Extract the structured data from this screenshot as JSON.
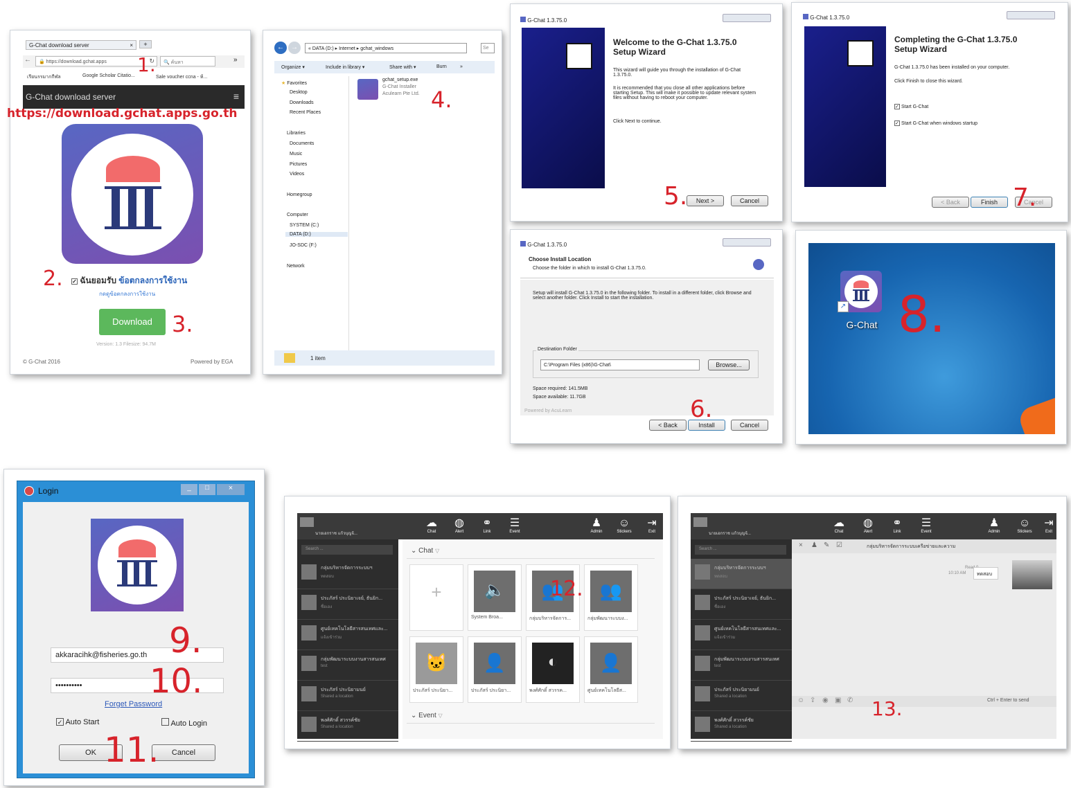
{
  "browser": {
    "tab_title": "G-Chat download server",
    "url": "https://download.gchat.apps",
    "search_placeholder": "ค้นหา",
    "bookmarks": [
      "เรียนรรมากกีฬล",
      "Google Scholar Citatio...",
      "Sale voucher ccna - ห้..."
    ],
    "page_header": "G-Chat download server",
    "url_caption": "https://download.gchat.apps.go.th",
    "accept_prefix": "ฉันยอมรับ",
    "accept_link": "ข้อตกลงการใช้งาน",
    "terms_link": "กดดูข้อตกลงการใช้งาน",
    "download_label": "Download",
    "version": "Version: 1.3 Filesize: 94.7M",
    "footer_left": "© G-Chat 2016",
    "footer_right": "Powered by EGA"
  },
  "explorer": {
    "path": "« DATA (D:) ▸ Internet ▸ gchat_windows",
    "search": "Se",
    "toolbar": [
      "Organize ▾",
      "Include in library ▾",
      "Share with ▾",
      "Burn",
      "»"
    ],
    "nav": [
      "Favorites",
      "Desktop",
      "Downloads",
      "Recent Places",
      "Libraries",
      "Documents",
      "Music",
      "Pictures",
      "Videos",
      "Homegroup",
      "Computer",
      "SYSTEM (C:)",
      "DATA (D:)",
      "JO-SDC (F:)",
      "Network"
    ],
    "file_name": "gchat_setup.exe",
    "file_desc": "G-Chat Installer",
    "file_company": "Aculearn Pte Ltd.",
    "status": "1 item"
  },
  "setup_welcome": {
    "title": "G-Chat 1.3.75.0",
    "heading": "Welcome to the G-Chat 1.3.75.0 Setup Wizard",
    "p1": "This wizard will guide you through the installation of G-Chat 1.3.75.0.",
    "p2": "It is recommended that you close all other applications before starting Setup. This will make it possible to update relevant system files without having to reboot your computer.",
    "p3": "Click Next to continue.",
    "next": "Next >",
    "cancel": "Cancel"
  },
  "setup_complete": {
    "title": "G-Chat 1.3.75.0",
    "heading": "Completing the G-Chat 1.3.75.0 Setup Wizard",
    "p1": "G-Chat 1.3.75.0 has been installed on your computer.",
    "p2": "Click Finish to close this wizard.",
    "cb1": "Start G-Chat",
    "cb2": "Start G-Chat when windows startup",
    "back": "< Back",
    "finish": "Finish",
    "cancel": "Cancel"
  },
  "setup_location": {
    "title": "G-Chat 1.3.75.0",
    "heading": "Choose Install Location",
    "sub": "Choose the folder in which to install G-Chat 1.3.75.0.",
    "p1": "Setup will install G-Chat 1.3.75.0 in the following folder. To install in a different folder, click Browse and select another folder. Click Install to start the installation.",
    "dest_label": "Destination Folder",
    "dest_value": "C:\\Program Files (x86)\\G-Chat\\",
    "browse": "Browse...",
    "space_req": "Space required: 141.5MB",
    "space_avail": "Space available: 11.7GB",
    "powered": "Powered by AcuLearn",
    "back": "< Back",
    "install": "Install",
    "cancel": "Cancel"
  },
  "desktop": {
    "icon_label": "G-Chat"
  },
  "login": {
    "title": "Login",
    "email": "akkaracihk@fisheries.go.th",
    "password": "••••••••••",
    "forget": "Forget Password",
    "auto_start": "Auto Start",
    "auto_login": "Auto Login",
    "ok": "OK",
    "cancel": "Cancel"
  },
  "gchat_main": {
    "user": "นายเอกราช แก้วบุญจ้...",
    "tools": [
      "Chat",
      "Alert",
      "Link",
      "Event"
    ],
    "tools_right": [
      "Admin",
      "Stickers",
      "Exit"
    ],
    "search": "Search ...",
    "chats": [
      {
        "t": "กลุ่มบริหารจัดการระบบฯ",
        "s": "ทดสอบ"
      },
      {
        "t": "ประภัสร์ ประนิยาเจย์, ธันยิก...",
        "s": "ชื่อเอง"
      },
      {
        "t": "ศูนย์เทคโนโลยีสารสนเทศและ...",
        "s": "แจ้งเข้าร่วม"
      },
      {
        "t": "กลุ่มพัฒนาระบบงานสารสนเทศ",
        "s": "test"
      },
      {
        "t": "ประภัสร์ ประนิยามนย์",
        "s": "Shared a location"
      },
      {
        "t": "พงศ์ศักดิ์ สวรรค์ชัย",
        "s": "Shared a location"
      }
    ],
    "section_chat": "Chat",
    "section_event": "Event",
    "tiles": [
      "System Broa...",
      "กลุ่มบริหารจัดการ...",
      "กลุ่มพัฒนาระบบง...",
      "ประภัสร์ ประนิยา...",
      "ประภัสร์ ประนิยา...",
      "พงศ์ศักดิ์ สวรรค...",
      "ศูนย์เทคโนโลยีส..."
    ]
  },
  "gchat_conv": {
    "group_title": "กลุ่มบริหารจัดการระบบเครือข่ายและความ",
    "read": "Read 0",
    "time": "10:10 AM",
    "msg": "ทดสอบ",
    "hint": "Ctrl + Enter to send"
  },
  "steps": [
    "1.",
    "2.",
    "3.",
    "4.",
    "5.",
    "6.",
    "7.",
    "8.",
    "9.",
    "10.",
    "11.",
    "12.",
    "13."
  ]
}
